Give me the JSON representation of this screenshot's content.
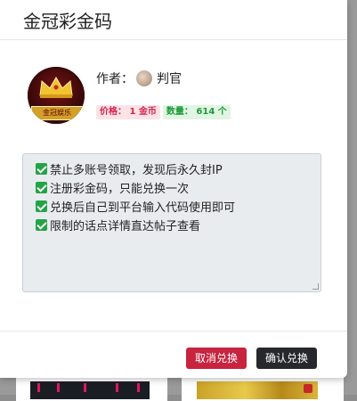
{
  "modal": {
    "title": "金冠彩金码"
  },
  "item": {
    "avatar_text": "金冠娱乐",
    "author_label": "作者：",
    "author_name": "判官",
    "price_badge": "价格： 1 金币",
    "count_badge": "数量： 614 个"
  },
  "rules": [
    "禁止多账号领取，发现后永久封IP",
    "注册彩金码，只能兑换一次",
    "兑换后自己到平台输入代码使用即可",
    "限制的话点详情直达帖子查看"
  ],
  "footer": {
    "cancel_label": "取消兑换",
    "confirm_label": "确认兑换"
  },
  "colors": {
    "cancel": "#c8233f",
    "confirm": "#26282c",
    "check": "#22a447",
    "price_text": "#d4254d",
    "count_text": "#1f9a3a"
  }
}
